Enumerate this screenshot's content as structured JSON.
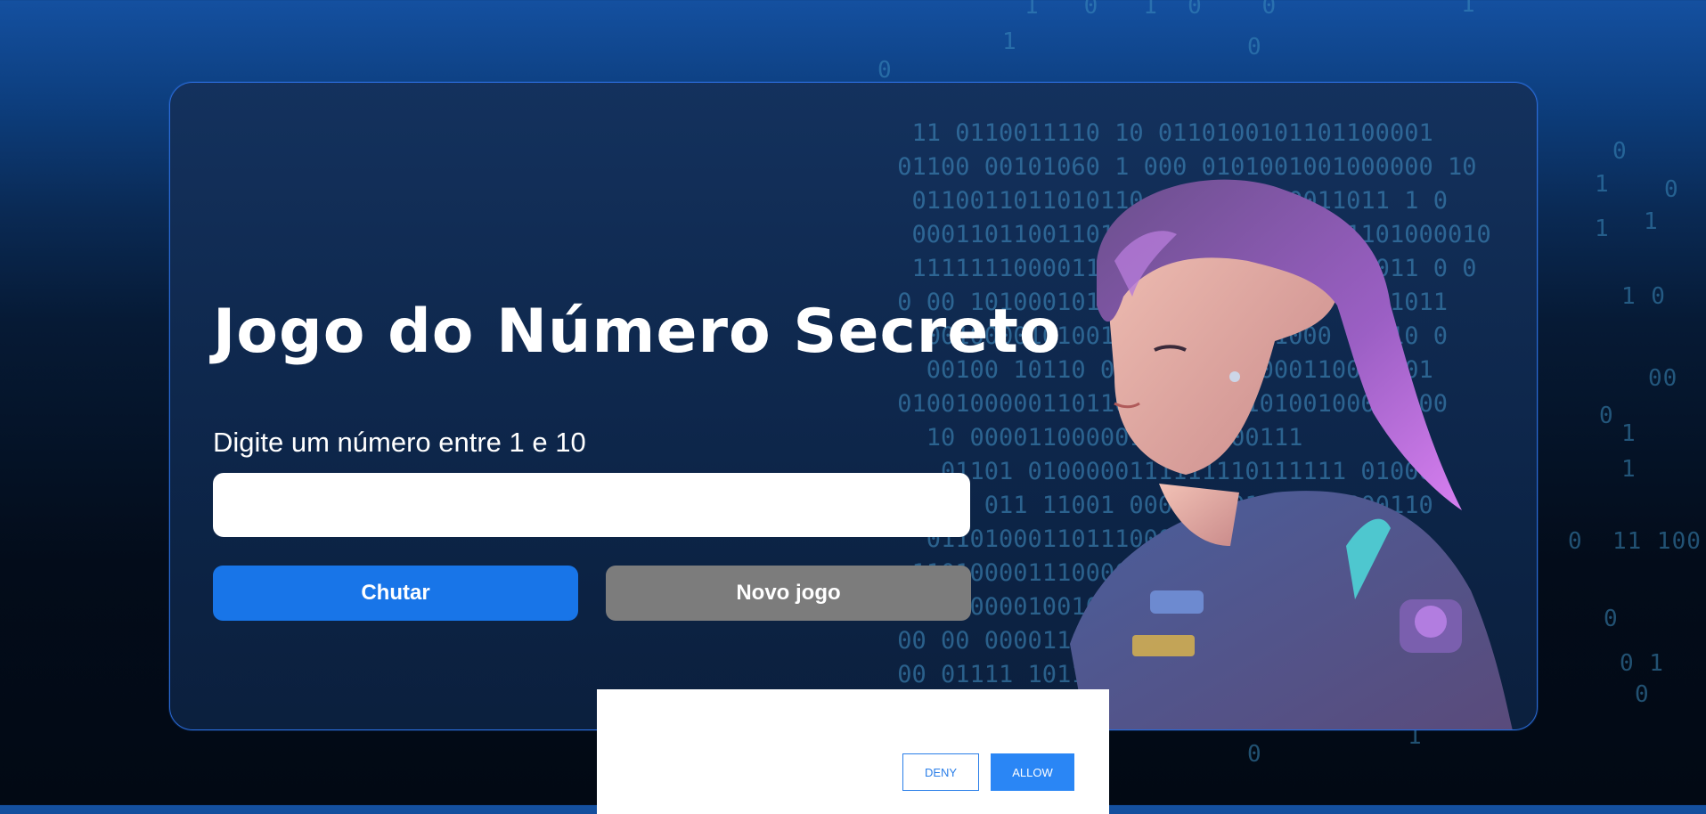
{
  "game": {
    "title": "Jogo do Número Secreto",
    "prompt": "Digite um número entre 1 e 10",
    "input_value": "",
    "guess_button": "Chutar",
    "new_game_button": "Novo jogo"
  },
  "consent": {
    "deny_label": "DENY",
    "allow_label": "ALLOW"
  },
  "colors": {
    "accent_blue": "#1875e8",
    "secondary_gray": "#7c7c7c",
    "card_border": "#2a6ad6"
  },
  "decorations": {
    "hero_image": "cyberpunk-girl-illustration",
    "background_pattern": "binary-code"
  }
}
